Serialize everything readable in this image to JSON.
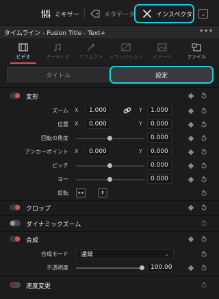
{
  "topbar": {
    "mixer_label": "ミキサー",
    "metadata_label": "メタデータ",
    "inspector_label": "インスペクタ"
  },
  "title": "タイムライン - Fusion Title - Text+",
  "tabs": [
    {
      "label": "ビデオ",
      "icon": "film-icon",
      "active": true
    },
    {
      "label": "オーディオ",
      "icon": "music-note-icon",
      "active": false
    },
    {
      "label": "エフェクト",
      "icon": "magic-wand-icon",
      "active": false
    },
    {
      "label": "トランジション",
      "icon": "transition-icon",
      "active": false
    },
    {
      "label": "イメージ",
      "icon": "image-icon",
      "active": false
    },
    {
      "label": "ファイル",
      "icon": "file-icon",
      "active": false
    }
  ],
  "segmented": {
    "title_label": "タイトル",
    "settings_label": "設定",
    "active": "settings"
  },
  "transform": {
    "label": "変形",
    "zoom": {
      "label": "ズーム",
      "x": "1.000",
      "y": "1.000"
    },
    "position": {
      "label": "位置",
      "x": "0.000",
      "y": "0.000"
    },
    "rotation": {
      "label": "回転の角度",
      "value": "0.000"
    },
    "anchor": {
      "label": "アンカーポイント",
      "x": "0.000",
      "y": "0.000"
    },
    "pitch": {
      "label": "ピッチ",
      "value": "0.000"
    },
    "yaw": {
      "label": "ヨー",
      "value": "0.000"
    },
    "flip": {
      "label": "反転"
    }
  },
  "crop": {
    "label": "クロップ"
  },
  "dynamic_zoom": {
    "label": "ダイナミックズーム"
  },
  "composite": {
    "label": "合成",
    "mode": {
      "label": "合成モード",
      "value": "通常"
    },
    "opacity": {
      "label": "不透明度",
      "value": "100.00"
    }
  },
  "speed": {
    "label": "速度変更"
  },
  "colors": {
    "accent": "#1fd0dc",
    "toggle_on": "#e2514f",
    "bg": "#1c1c1e"
  }
}
